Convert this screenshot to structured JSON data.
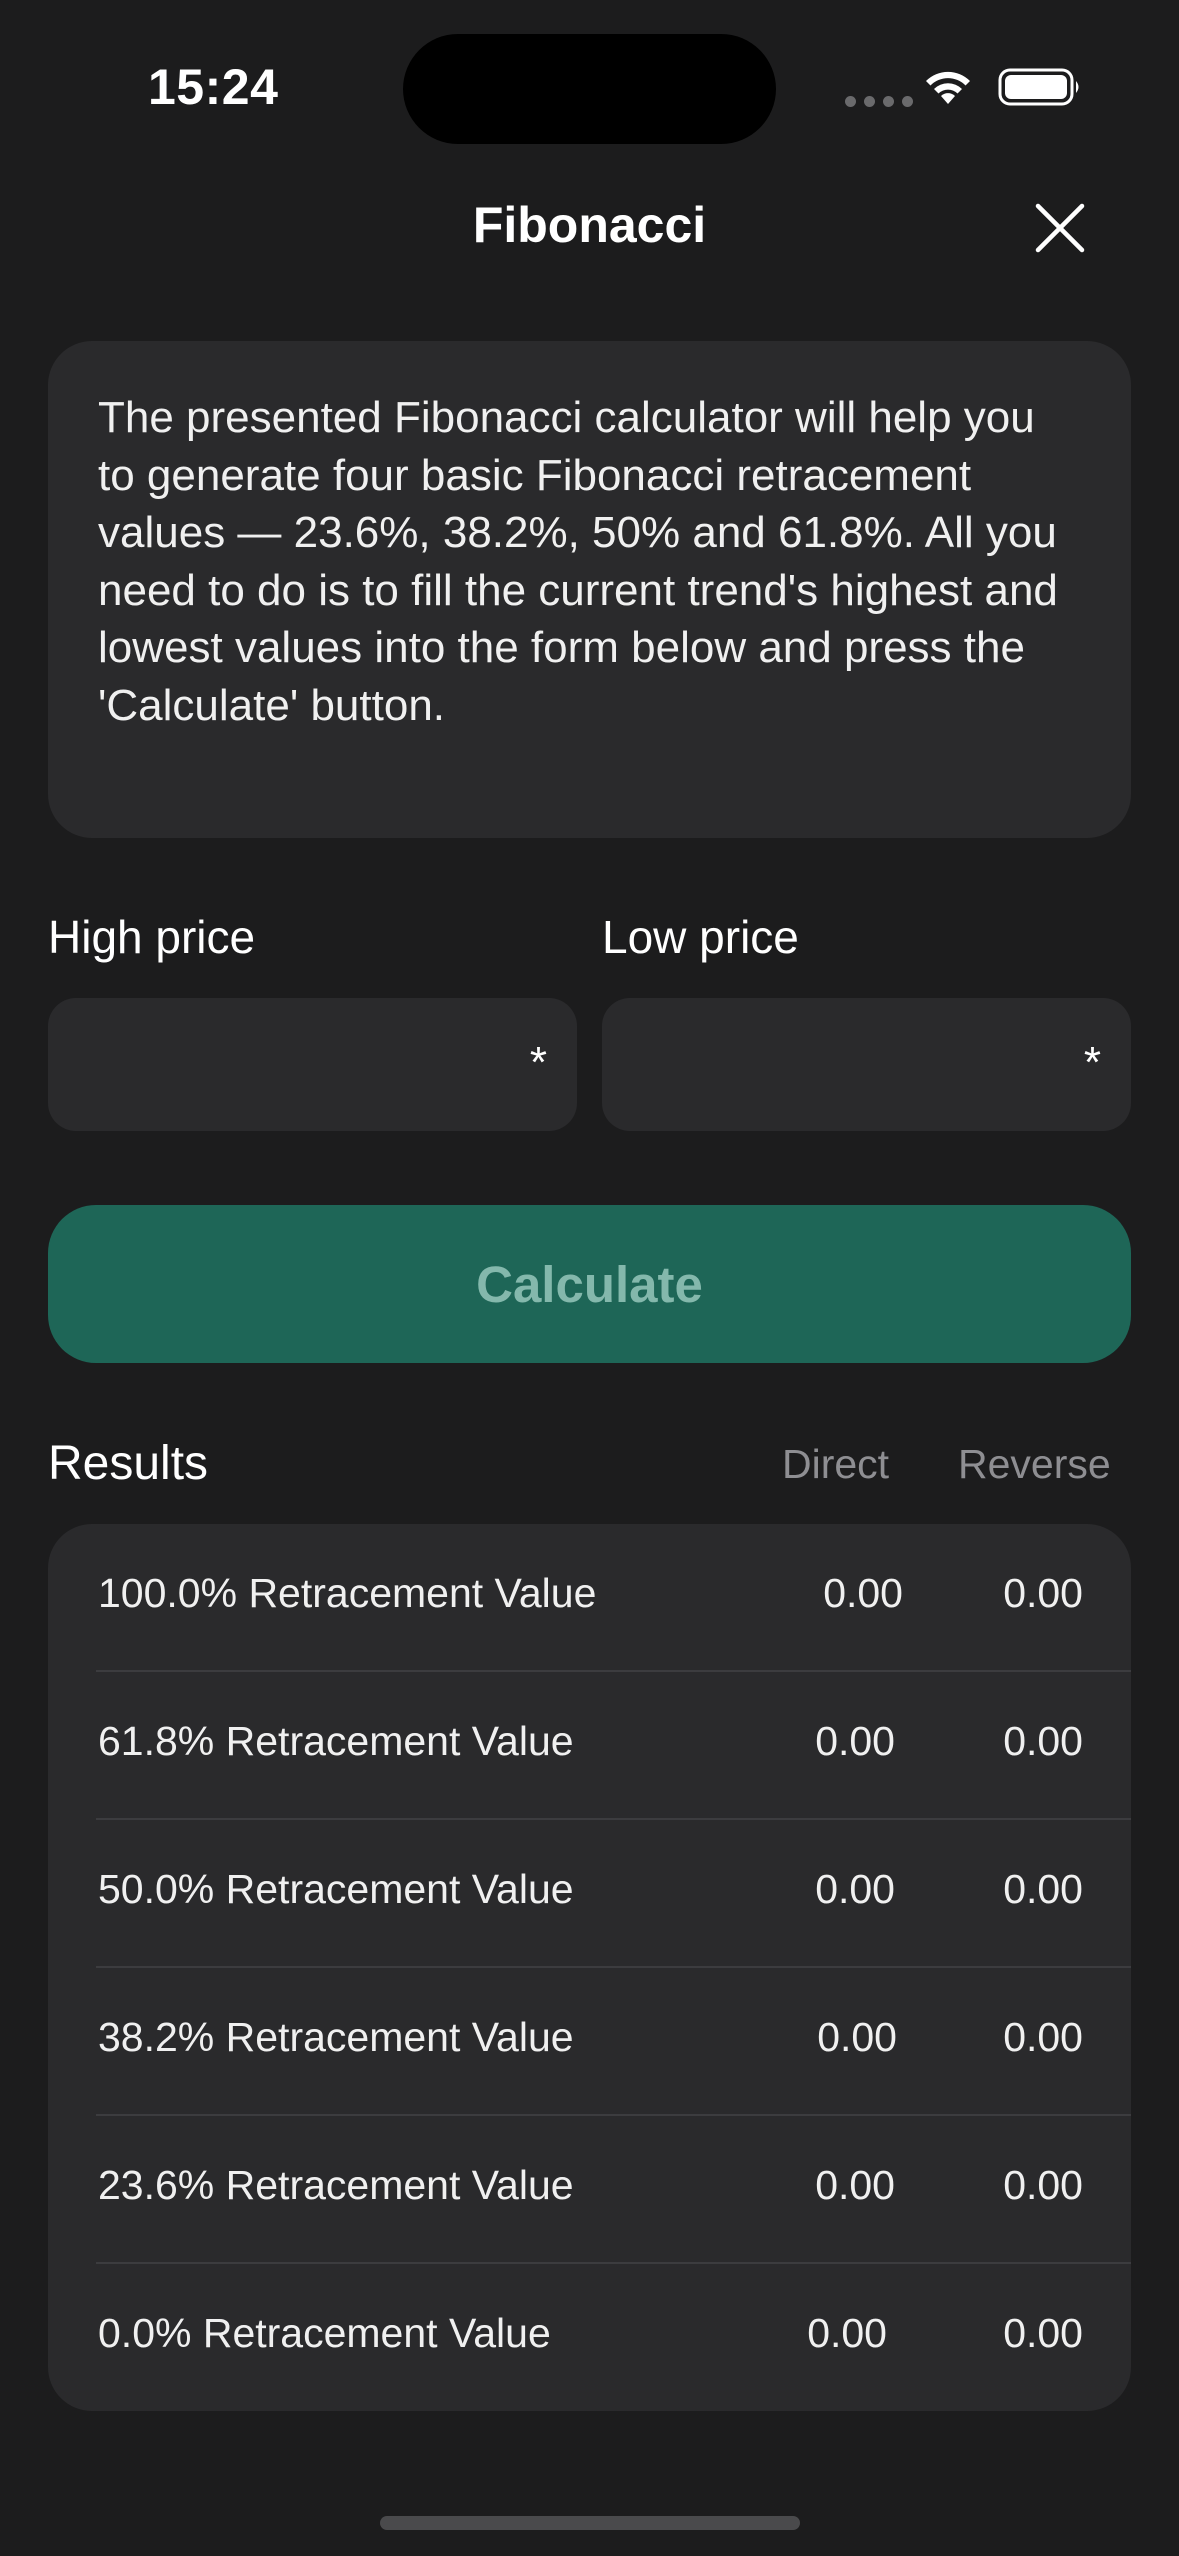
{
  "status_bar": {
    "time": "15:24",
    "icons": [
      "signal-dots-icon",
      "wifi-icon",
      "battery-icon"
    ]
  },
  "header": {
    "title": "Fibonacci",
    "close_icon": "close-icon"
  },
  "info": {
    "text": "The presented Fibonacci calculator will help you to generate four basic Fibonacci retracement values — 23.6%, 38.2%, 50% and 61.8%. All you need to do is to fill the current trend's highest and lowest values into the form below and press the 'Calculate' button."
  },
  "form": {
    "high_label": "High price",
    "high_value": "",
    "high_required": "*",
    "low_label": "Low price",
    "low_value": "",
    "low_required": "*",
    "calculate_label": "Calculate"
  },
  "results": {
    "title": "Results",
    "direct_header": "Direct",
    "reverse_header": "Reverse",
    "rows": [
      {
        "label": "100.0% Retracement Value",
        "direct": "0.00",
        "reverse": "0.00"
      },
      {
        "label": "61.8% Retracement Value",
        "direct": "0.00",
        "reverse": "0.00"
      },
      {
        "label": "50.0% Retracement Value",
        "direct": "0.00",
        "reverse": "0.00"
      },
      {
        "label": "38.2% Retracement Value",
        "direct": "0.00",
        "reverse": "0.00"
      },
      {
        "label": "23.6% Retracement Value",
        "direct": "0.00",
        "reverse": "0.00"
      },
      {
        "label": "0.0% Retracement Value",
        "direct": "0.00",
        "reverse": "0.00"
      }
    ]
  },
  "colors": {
    "background": "#1c1c1d",
    "card": "#2a2a2c",
    "accent_button": "#1e6657",
    "accent_button_text": "#84b8ac",
    "muted_text": "#8e8e92"
  }
}
